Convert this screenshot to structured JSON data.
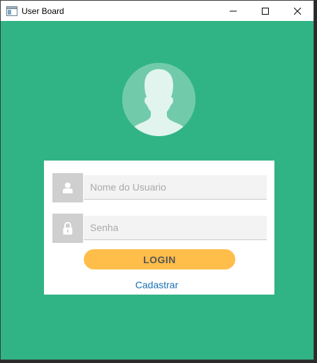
{
  "window": {
    "title": "User Board",
    "minimize_icon": "minimize-icon",
    "maximize_icon": "maximize-icon",
    "close_icon": "close-icon"
  },
  "avatar": {
    "icon": "user-silhouette-icon"
  },
  "form": {
    "username_placeholder": "Nome do Usuario",
    "username_value": "",
    "username_icon": "user-icon",
    "password_placeholder": "Senha",
    "password_value": "",
    "password_icon": "lock-icon",
    "login_label": "LOGIN",
    "register_label": "Cadastrar"
  },
  "colors": {
    "background": "#31b485",
    "avatar_circle": "#71cbab",
    "login_button": "#ffbd4a",
    "link": "#1a6fb5"
  }
}
